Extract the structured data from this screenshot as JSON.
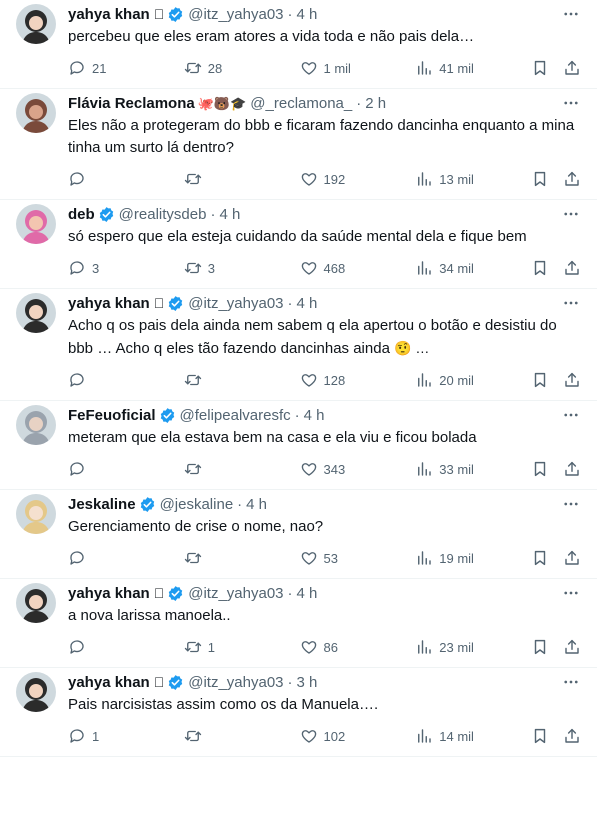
{
  "icons": {
    "reply": "reply-icon",
    "repost": "repost-icon",
    "like": "heart-icon",
    "views": "views-chart-icon",
    "bookmark": "bookmark-icon",
    "share": "share-icon",
    "more": "more-dots-icon",
    "verified": "verified-badge-icon"
  },
  "colors": {
    "verified": "#1d9bf0",
    "muted": "#536471",
    "text": "#0f1419",
    "divider": "#eff3f4"
  },
  "tweets": [
    {
      "name": "yahya khan",
      "badge_apple": "",
      "verified": true,
      "emojis": "",
      "handle": "@itz_yahya03",
      "dot": "·",
      "time": "4 h",
      "text": "percebeu que eles eram atores a vida toda e não pais dela…",
      "emoji_after": "",
      "replies": "21",
      "reposts": "28",
      "likes": "1 mil",
      "views": "41 mil"
    },
    {
      "name": "Flávia Reclamona",
      "badge_apple": "",
      "verified": false,
      "emojis": "🐙🐻🎓",
      "handle": "@_reclamona_",
      "dot": "·",
      "time": "2 h",
      "text": "Eles não a protegeram do bbb e ficaram fazendo dancinha enquanto a mina tinha um surto lá dentro?",
      "emoji_after": "",
      "replies": "",
      "reposts": "",
      "likes": "192",
      "views": "13 mil"
    },
    {
      "name": "deb",
      "badge_apple": "",
      "verified": true,
      "emojis": "",
      "handle": "@realitysdeb",
      "dot": "·",
      "time": "4 h",
      "text": "só espero que ela esteja cuidando da saúde mental dela e fique bem",
      "emoji_after": "",
      "replies": "3",
      "reposts": "3",
      "likes": "468",
      "views": "34 mil"
    },
    {
      "name": "yahya khan",
      "badge_apple": "",
      "verified": true,
      "emojis": "",
      "handle": "@itz_yahya03",
      "dot": "·",
      "time": "4 h",
      "text": "Acho q os pais dela ainda nem sabem q ela apertou o botão e desistiu do bbb … Acho q eles tão fazendo dancinhas ainda",
      "emoji_after": "🤨 …",
      "replies": "",
      "reposts": "",
      "likes": "128",
      "views": "20 mil"
    },
    {
      "name": "FeFeuoficial",
      "badge_apple": "",
      "verified": true,
      "emojis": "",
      "handle": "@felipealvaresfc",
      "dot": "·",
      "time": "4 h",
      "text": "meteram que ela estava bem na casa e ela viu e ficou bolada",
      "emoji_after": "",
      "replies": "",
      "reposts": "",
      "likes": "343",
      "views": "33 mil"
    },
    {
      "name": "Jeskaline",
      "badge_apple": "",
      "verified": true,
      "emojis": "",
      "handle": "@jeskaline",
      "dot": "·",
      "time": "4 h",
      "text": "Gerenciamento de crise o nome, nao?",
      "emoji_after": "",
      "replies": "",
      "reposts": "",
      "likes": "53",
      "views": "19 mil"
    },
    {
      "name": "yahya khan",
      "badge_apple": "",
      "verified": true,
      "emojis": "",
      "handle": "@itz_yahya03",
      "dot": "·",
      "time": "4 h",
      "text": "a nova larissa manoela..",
      "emoji_after": "",
      "replies": "",
      "reposts": "1",
      "likes": "86",
      "views": "23 mil"
    },
    {
      "name": "yahya khan",
      "badge_apple": "",
      "verified": true,
      "emojis": "",
      "handle": "@itz_yahya03",
      "dot": "·",
      "time": "3 h",
      "text": "Pais narcisistas assim como os da Manuela….",
      "emoji_after": "",
      "replies": "1",
      "reposts": "",
      "likes": "102",
      "views": "14 mil"
    }
  ]
}
